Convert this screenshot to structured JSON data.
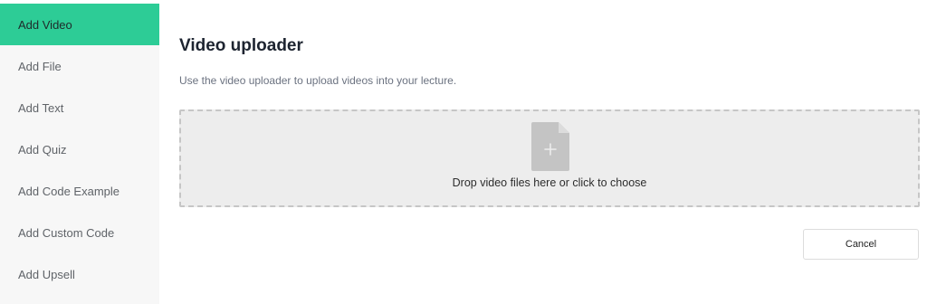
{
  "sidebar": {
    "items": [
      {
        "label": "Add Video",
        "active": true
      },
      {
        "label": "Add File",
        "active": false
      },
      {
        "label": "Add Text",
        "active": false
      },
      {
        "label": "Add Quiz",
        "active": false
      },
      {
        "label": "Add Code Example",
        "active": false
      },
      {
        "label": "Add Custom Code",
        "active": false
      },
      {
        "label": "Add Upsell",
        "active": false
      }
    ]
  },
  "main": {
    "title": "Video uploader",
    "description": "Use the video uploader to upload videos into your lecture.",
    "dropzone": {
      "icon": "file-add-icon",
      "text": "Drop video files here or click to choose"
    },
    "cancel_label": "Cancel"
  },
  "colors": {
    "accent": "#2dcc96",
    "sidebar_bg": "#f7f7f7",
    "dropzone_bg": "#ededed",
    "dropzone_border": "#c6c6c6",
    "icon": "#c4c4c4"
  }
}
